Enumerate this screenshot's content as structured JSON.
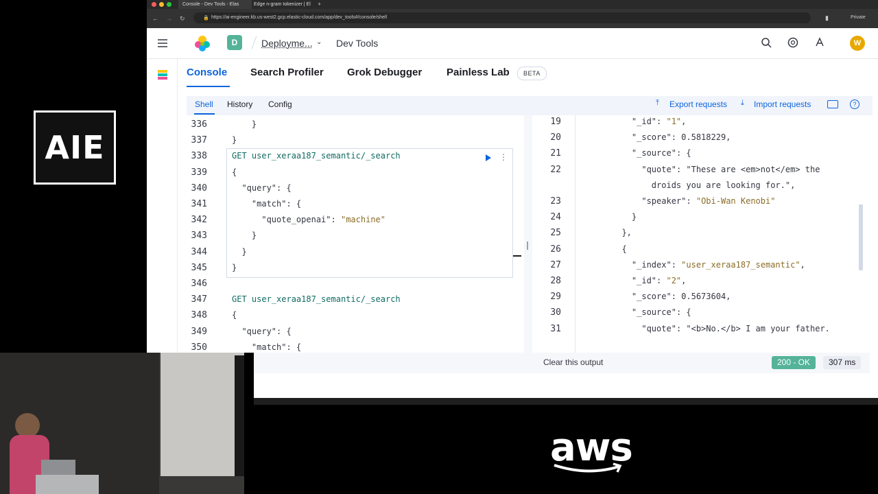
{
  "slide": {
    "logo_text": "AIE",
    "sponsor_logo": "aws"
  },
  "browser": {
    "tabs": [
      {
        "title": "Console - Dev Tools - Elas"
      },
      {
        "title": "Edge n-gram tokenizer | El"
      }
    ],
    "url": "https://ai-engineer.kb.us-west2.gcp.elastic-cloud.com/app/dev_tools#/console/shell",
    "private_label": "Private"
  },
  "header": {
    "space_initial": "D",
    "breadcrumb_deployment": "Deployme...",
    "breadcrumb_page": "Dev Tools",
    "user_initial": "W"
  },
  "app_tabs": [
    {
      "label": "Console",
      "active": true
    },
    {
      "label": "Search Profiler"
    },
    {
      "label": "Grok Debugger"
    },
    {
      "label": "Painless Lab"
    }
  ],
  "beta_badge": "BETA",
  "sub_tabs": [
    {
      "label": "Shell",
      "active": true
    },
    {
      "label": "History"
    },
    {
      "label": "Config"
    }
  ],
  "actions": {
    "export": "Export requests",
    "import": "Import requests"
  },
  "request_editor": {
    "lines": [
      {
        "n": "336",
        "text": "    }"
      },
      {
        "n": "337",
        "text": "}"
      },
      {
        "n": "338",
        "method": "GET",
        "text": "user_xeraa187_semantic/_search"
      },
      {
        "n": "339",
        "text": "{"
      },
      {
        "n": "340",
        "text": "  \"query\": {"
      },
      {
        "n": "341",
        "text": "    \"match\": {"
      },
      {
        "n": "342",
        "text": "      \"quote_openai\": \"machine\""
      },
      {
        "n": "343",
        "text": "    }"
      },
      {
        "n": "344",
        "text": "  }"
      },
      {
        "n": "345",
        "text": "}"
      },
      {
        "n": "346",
        "text": ""
      },
      {
        "n": "347",
        "method": "GET",
        "text": "user_xeraa187_semantic/_search"
      },
      {
        "n": "348",
        "text": "{"
      },
      {
        "n": "349",
        "text": "  \"query\": {"
      },
      {
        "n": "350",
        "text": "    \"match\": {"
      }
    ]
  },
  "response_editor": {
    "lines": [
      {
        "n": "19",
        "text": "    \"_id\": \"1\","
      },
      {
        "n": "20",
        "text": "    \"_score\": 0.5818229,"
      },
      {
        "n": "21",
        "text": "    \"_source\": {"
      },
      {
        "n": "22",
        "text": "      \"quote\": \"These are <em>not</em> the"
      },
      {
        "n": "",
        "text": "        droids you are looking for.\","
      },
      {
        "n": "23",
        "text": "      \"speaker\": \"Obi-Wan Kenobi\""
      },
      {
        "n": "24",
        "text": "    }"
      },
      {
        "n": "25",
        "text": "  },"
      },
      {
        "n": "26",
        "text": "  {"
      },
      {
        "n": "27",
        "text": "    \"_index\": \"user_xeraa187_semantic\","
      },
      {
        "n": "28",
        "text": "    \"_id\": \"2\","
      },
      {
        "n": "29",
        "text": "    \"_score\": 0.5673604,"
      },
      {
        "n": "30",
        "text": "    \"_source\": {"
      },
      {
        "n": "31",
        "text": "      \"quote\": \"<b>No.</b> I am your father."
      }
    ]
  },
  "status": {
    "clear_output": "Clear this output",
    "response_code": "200 - OK",
    "duration": "307 ms",
    "left_hint": "t"
  },
  "colors": {
    "accent": "#0b64dd",
    "ok_badge": "#54b399",
    "method": "#0f6b63",
    "string": "#8a6c26"
  }
}
